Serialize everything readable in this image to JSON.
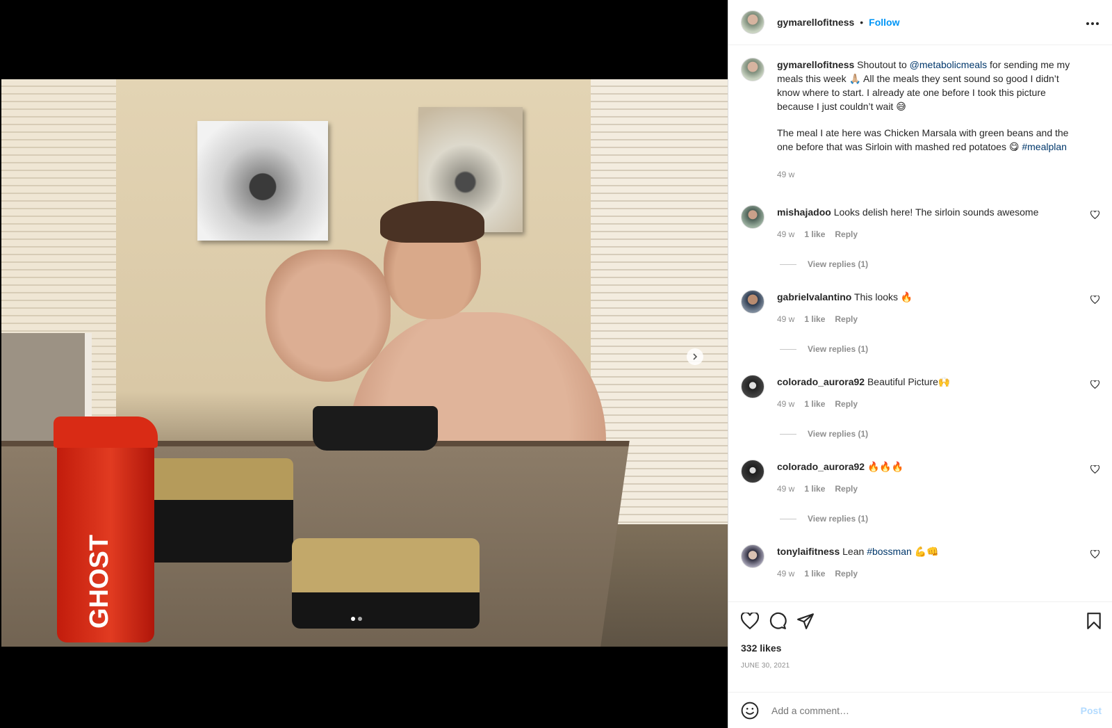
{
  "post": {
    "username": "gymarellofitness",
    "separator": "•",
    "follow_label": "Follow",
    "more_label": "•••",
    "caption": {
      "username": "gymarellofitness",
      "line1_a": "Shoutout to ",
      "mention": "@metabolicmeals",
      "line1_b": " for sending me my meals this week 🙏🏼 All the meals they sent sound so good I didn’t know where to start. I already ate one before I took this picture because I just couldn’t wait 😅",
      "para2_a": "The meal I ate here was Chicken Marsala with green beans and the one before that was Sirloin with mashed red potatoes 😋 ",
      "hashtag": "#mealplan",
      "age": "49 w"
    },
    "comments": [
      {
        "username": "mishajadoo",
        "text": "Looks delish here! The sirloin sounds awesome",
        "age": "49 w",
        "likes": "1 like",
        "reply": "Reply",
        "view_replies": "View replies (1)"
      },
      {
        "username": "gabrielvalantino",
        "text": "This looks 🔥",
        "age": "49 w",
        "likes": "1 like",
        "reply": "Reply",
        "view_replies": "View replies (1)"
      },
      {
        "username": "colorado_aurora92",
        "text": "Beautiful Picture🙌",
        "age": "49 w",
        "likes": "1 like",
        "reply": "Reply",
        "view_replies": "View replies (1)"
      },
      {
        "username": "colorado_aurora92",
        "text": "🔥🔥🔥",
        "age": "49 w",
        "likes": "1 like",
        "reply": "Reply",
        "view_replies": "View replies (1)"
      },
      {
        "username": "tonylaifitness",
        "text_a": "Lean ",
        "hashtag": "#bossman",
        "text_b": " 💪👊",
        "age": "49 w",
        "likes": "1 like",
        "reply": "Reply"
      }
    ],
    "likes": "332 likes",
    "date": "JUNE 30, 2021",
    "comment_placeholder": "Add a comment…",
    "post_button": "Post",
    "bottle_logo": "GHOST",
    "carousel": {
      "count": 2,
      "active": 1
    }
  },
  "colors": {
    "link_blue": "#0095f6",
    "mention": "#00376b",
    "meta_gray": "#8e8e8e"
  }
}
